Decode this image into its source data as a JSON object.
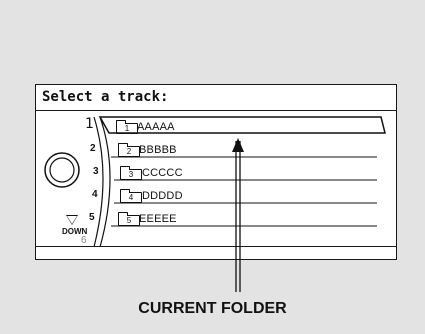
{
  "screen": {
    "title": "Select a track:"
  },
  "tracks": [
    {
      "number": "1",
      "folder": "1",
      "name": "AAAAA",
      "current": true
    },
    {
      "number": "2",
      "folder": "2",
      "name": "BBBBB",
      "current": false
    },
    {
      "number": "3",
      "folder": "3",
      "name": "CCCCC",
      "current": false
    },
    {
      "number": "4",
      "folder": "4",
      "name": "DDDDD",
      "current": false
    },
    {
      "number": "5",
      "folder": "5",
      "name": "EEEEE",
      "current": false
    }
  ],
  "next_number": "6",
  "down_label": "DOWN",
  "callout": {
    "label": "CURRENT FOLDER"
  },
  "icons": [
    "folder-icon",
    "selector-knob-icon",
    "down-arrow-icon",
    "pointer-arrow-icon"
  ],
  "colors": {
    "background": "#e3e3e3",
    "screen": "#ffffff",
    "ink": "#111111"
  }
}
